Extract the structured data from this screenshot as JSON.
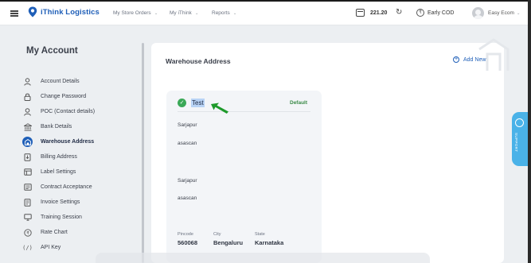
{
  "header": {
    "logo_text": "iThink Logistics",
    "nav": [
      {
        "label": "My Store Orders"
      },
      {
        "label": "My iThink"
      },
      {
        "label": "Reports"
      }
    ],
    "balance": "221.20",
    "cod_label": "Early COD",
    "user_name": "Easy Ecom"
  },
  "sidebar": {
    "title": "My Account",
    "items": [
      {
        "label": "Account Details",
        "icon": "user-icon"
      },
      {
        "label": "Change Password",
        "icon": "lock-icon"
      },
      {
        "label": "POC (Contact details)",
        "icon": "contact-icon"
      },
      {
        "label": "Bank Details",
        "icon": "bank-icon"
      },
      {
        "label": "Warehouse Address",
        "icon": "warehouse-icon",
        "active": true
      },
      {
        "label": "Billing Address",
        "icon": "billing-icon"
      },
      {
        "label": "Label Settings",
        "icon": "label-icon"
      },
      {
        "label": "Contract Acceptance",
        "icon": "contract-icon"
      },
      {
        "label": "Invoice Settings",
        "icon": "invoice-icon"
      },
      {
        "label": "Training Session",
        "icon": "monitor-icon"
      },
      {
        "label": "Rate Chart",
        "icon": "rupee-icon"
      },
      {
        "label": "API Key",
        "icon": "code-icon"
      }
    ]
  },
  "main": {
    "title": "Warehouse Address",
    "add_new_label": "Add New",
    "card": {
      "name": "Test",
      "default_label": "Default",
      "lines": [
        "Sarjapur",
        "asascan",
        "Sarjapur",
        "asascan"
      ],
      "pincode_label": "Pincode",
      "pincode": "560068",
      "city_label": "City",
      "city": "Bengaluru",
      "state_label": "State",
      "state": "Karnataka"
    }
  },
  "support": {
    "label": "SUPPORT"
  },
  "colors": {
    "brand": "#1f5fb8",
    "default_green": "#3a8a47",
    "check_green": "#3aa857",
    "support_blue": "#4ab2e8"
  }
}
